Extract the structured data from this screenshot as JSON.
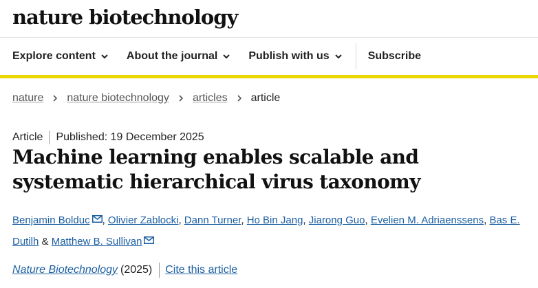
{
  "header": {
    "logo_text": "nature biotechnology"
  },
  "nav": {
    "items": [
      {
        "label": "Explore content",
        "icon": "chevron-down-icon"
      },
      {
        "label": "About the journal",
        "icon": "chevron-down-icon"
      },
      {
        "label": "Publish with us",
        "icon": "chevron-down-icon"
      }
    ],
    "subscribe_label": "Subscribe",
    "accent_color": "#ecd600"
  },
  "breadcrumb": {
    "items": [
      "nature",
      "nature biotechnology",
      "articles"
    ],
    "current": "article"
  },
  "article": {
    "type": "Article",
    "published": "Published: 19 December 2025",
    "title": "Machine learning enables scalable and systematic hierarchical virus taxonomy",
    "authors": [
      "Benjamin Bolduc",
      "Olivier Zablocki",
      "Dann Turner",
      "Ho Bin Jang",
      "Jiarong Guo",
      "Evelien M. Adriaenssens",
      "Bas E. Dutilh",
      "Matthew B. Sullivan"
    ],
    "author_separator": ",",
    "last_joiner": "&",
    "journal": "Nature Biotechnology",
    "year": "(2025)",
    "cite_label": "Cite this article",
    "link_color": "#1c5fa2"
  }
}
